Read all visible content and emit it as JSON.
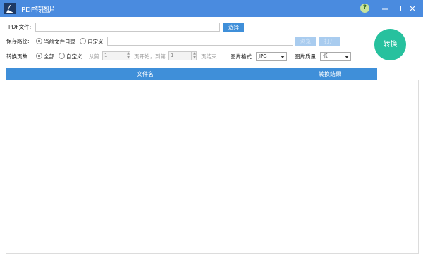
{
  "window": {
    "title": "PDF转图片",
    "help": "?"
  },
  "pdf_file": {
    "label": "PDF文件:",
    "value": "",
    "select_button": "选择"
  },
  "save_path": {
    "label": "保存路径:",
    "option_current": "当前文件目录",
    "option_custom": "自定义",
    "selected": "current",
    "path_value": "",
    "browse_button": "浏览",
    "open_button": "打开"
  },
  "page_range": {
    "label": "转换页数:",
    "option_all": "全部",
    "option_custom": "自定义",
    "selected": "all",
    "from_label": "从第",
    "from_value": "1",
    "start_label": "页开始，到第",
    "to_value": "1",
    "end_label": "页结束"
  },
  "image_format": {
    "label": "图片格式",
    "value": "JPG"
  },
  "image_quality": {
    "label": "图片质量",
    "value": "低"
  },
  "convert_button": "转换",
  "table": {
    "columns": [
      "文件名",
      "转换结果"
    ],
    "rows": []
  }
}
